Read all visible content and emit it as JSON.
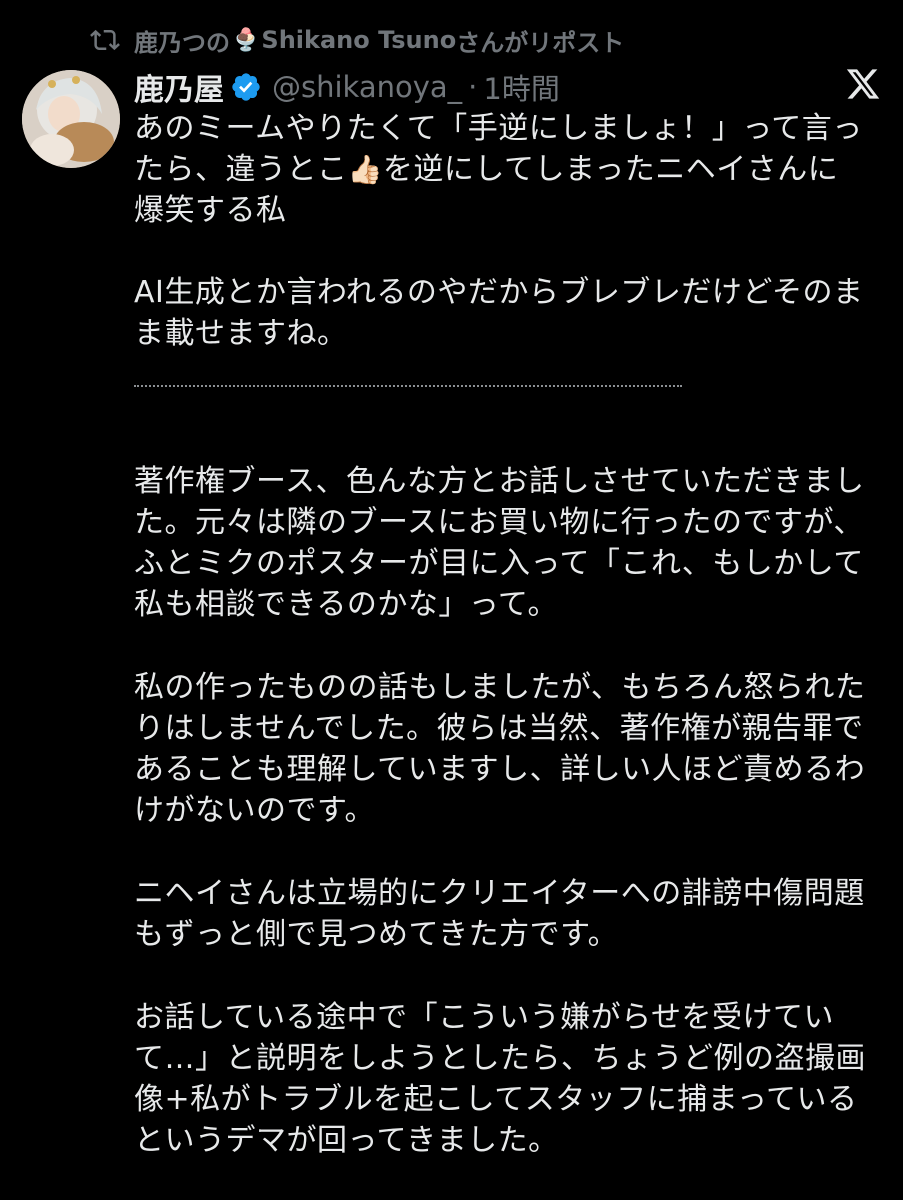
{
  "repost": {
    "name_prefix": "鹿乃つの",
    "emoji": "🍨",
    "name_suffix": "Shikano Tsuno",
    "label": "さんがリポスト"
  },
  "tweet": {
    "author_name": "鹿乃屋",
    "handle": "@shikanoya_",
    "separator": "·",
    "time": "1時間",
    "paragraph1": {
      "line1": "あのミームやりたくて「手逆にしましょ！」って言っ",
      "line2_a": "たら、違うとこ",
      "line2_emoji": "👍🏻",
      "line2_b": "を逆にしてしまったニヘイさんに",
      "line3": "爆笑する私"
    },
    "paragraph2": {
      "line1": "AI生成とか言われるのやだからブレブレだけどそのま",
      "line2": "ま載せますね。"
    },
    "paragraph3": {
      "line1": "著作権ブース、色んな方とお話しさせていただきまし",
      "line2": "た。元々は隣のブースにお買い物に行ったのですが、",
      "line3": "ふとミクのポスターが目に入って「これ、もしかして",
      "line4": "私も相談できるのかな」って。"
    },
    "paragraph4": {
      "line1": "私の作ったものの話もしましたが、もちろん怒られた",
      "line2": "りはしませんでした。彼らは当然、著作権が親告罪で",
      "line3": "あることも理解していますし、詳しい人ほど責めるわ",
      "line4": "けがないのです。"
    },
    "paragraph5": {
      "line1": "ニヘイさんは立場的にクリエイターへの誹謗中傷問題",
      "line2": "もずっと側で見つめてきた方です。"
    },
    "paragraph6": {
      "line1": "お話している途中で「こういう嫌がらせを受けてい",
      "line2": "て…」と説明をしようとしたら、ちょうど例の盗撮画",
      "line3": "像+私がトラブルを起こしてスタッフに捕まっている",
      "line4": "というデマが回ってきました。"
    }
  },
  "icons": {
    "repost": "repost-icon",
    "verified": "verified-badge-icon",
    "platform": "x-logo-icon"
  },
  "colors": {
    "background": "#000000",
    "text": "#e7e9ea",
    "secondary": "#71767b",
    "verified": "#1d9bf0"
  }
}
